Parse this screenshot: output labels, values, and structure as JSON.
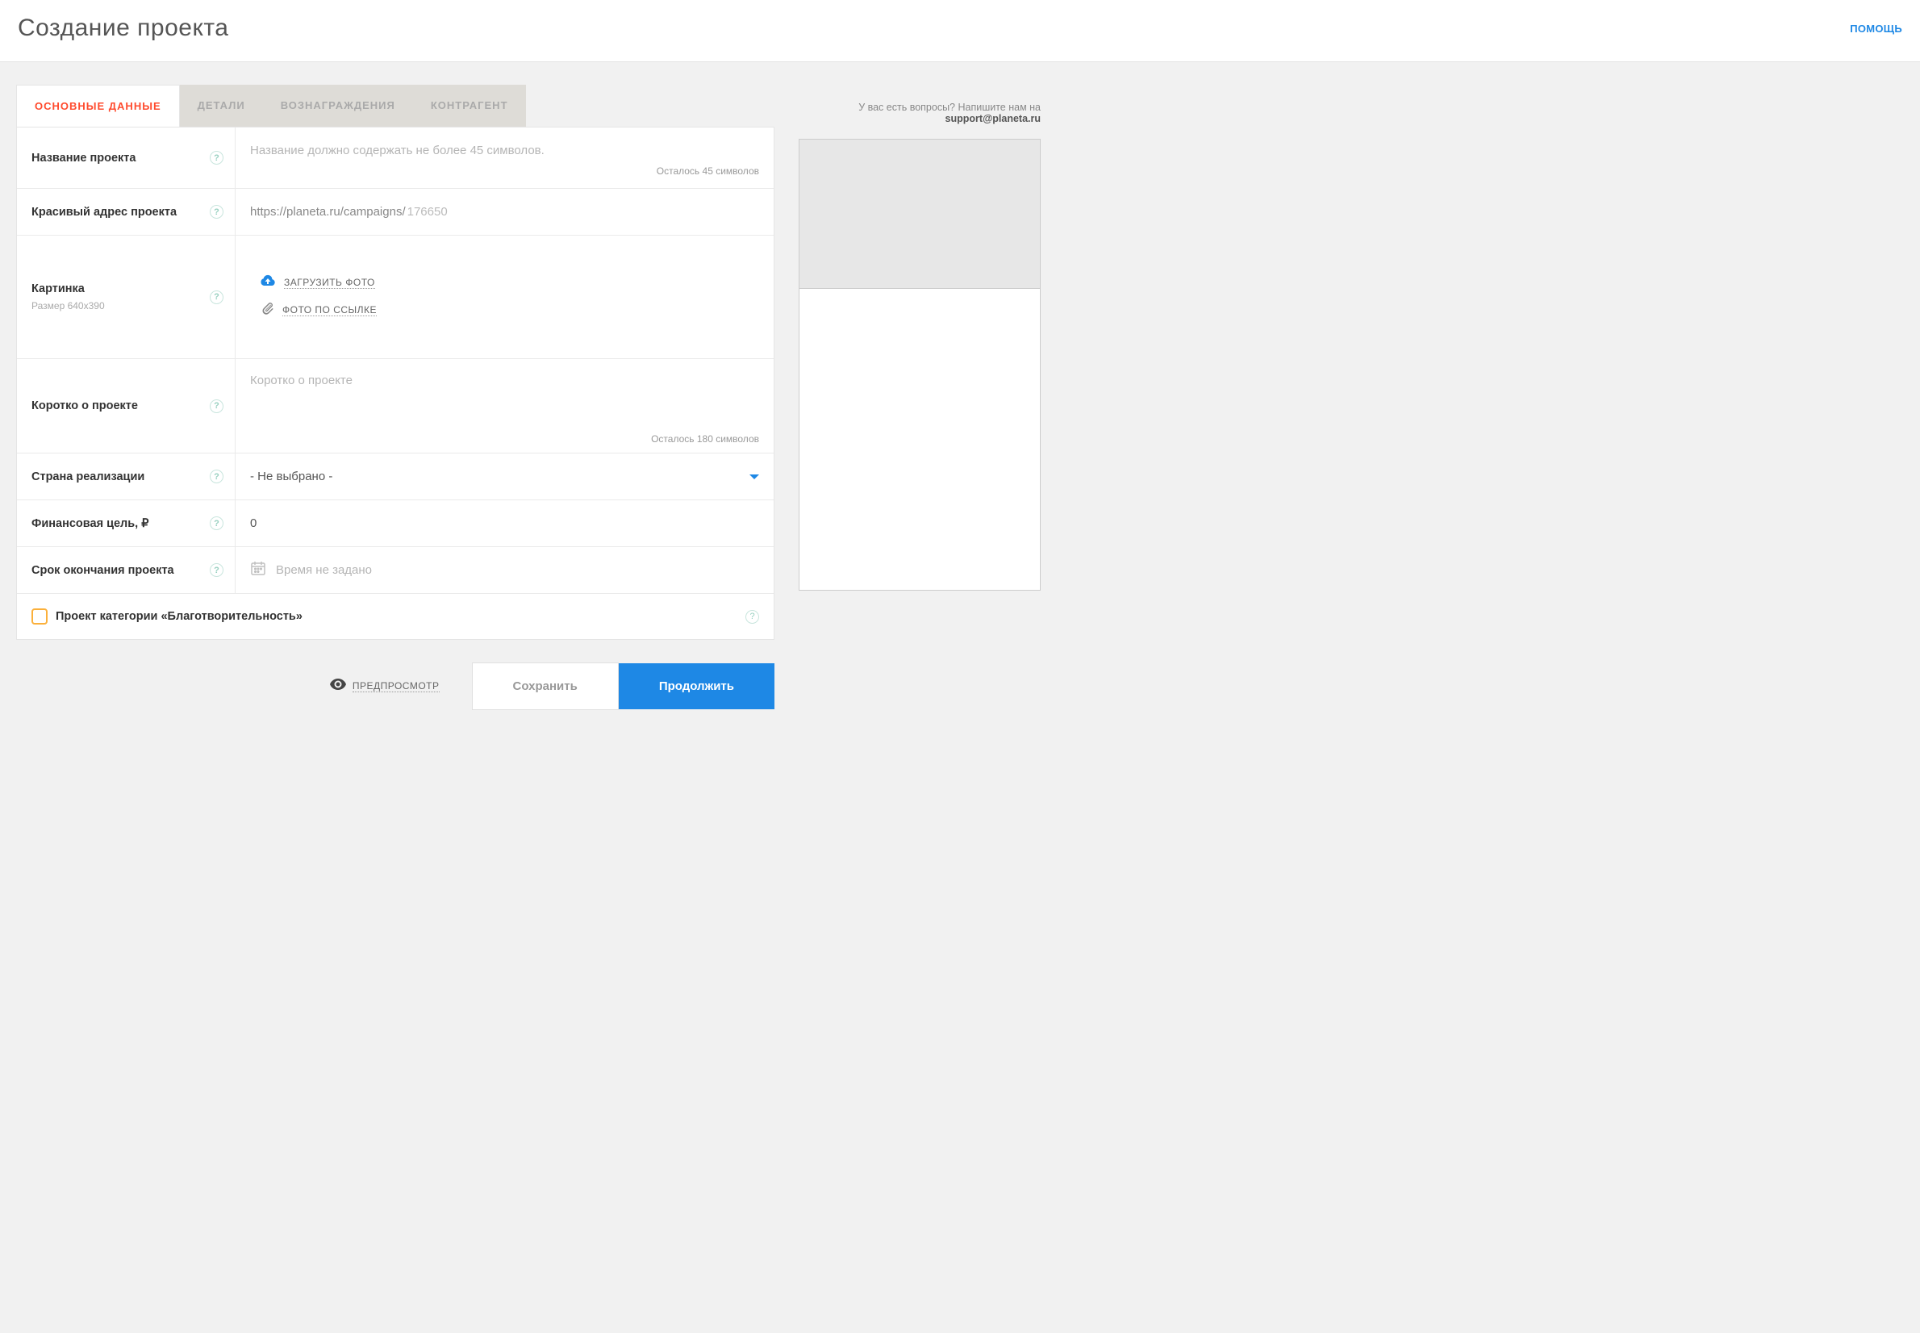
{
  "header": {
    "title": "Создание проекта",
    "help": "ПОМОЩЬ"
  },
  "support": {
    "prefix": "У вас есть вопросы? Напишите нам на ",
    "email": "support@planeta.ru"
  },
  "tabs": [
    {
      "label": "ОСНОВНЫЕ ДАННЫЕ",
      "active": true
    },
    {
      "label": "ДЕТАЛИ",
      "active": false
    },
    {
      "label": "ВОЗНАГРАЖДЕНИЯ",
      "active": false
    },
    {
      "label": "КОНТРАГЕНТ",
      "active": false
    }
  ],
  "form": {
    "name": {
      "label": "Название проекта",
      "placeholder": "Название должно содержать не более 45 символов.",
      "counter": "Осталось 45 символов"
    },
    "url": {
      "label": "Красивый адрес проекта",
      "prefix": "https://planeta.ru/campaigns/",
      "slug": "176650"
    },
    "image": {
      "label": "Картинка",
      "sublabel": "Размер 640х390",
      "upload": "ЗАГРУЗИТЬ ФОТО",
      "link": "ФОТО ПО ССЫЛКЕ"
    },
    "brief": {
      "label": "Коротко о проекте",
      "placeholder": "Коротко о проекте",
      "counter": "Осталось 180 символов"
    },
    "country": {
      "label": "Страна реализации",
      "value": "- Не выбрано -"
    },
    "goal": {
      "label": "Финансовая цель, ₽",
      "value": "0"
    },
    "deadline": {
      "label": "Срок окончания проекта",
      "placeholder": "Время не задано"
    },
    "charity": {
      "label": "Проект категории «Благотворительность»"
    }
  },
  "footer": {
    "preview": "ПРЕДПРОСМОТР",
    "save": "Сохранить",
    "continue": "Продолжить"
  }
}
